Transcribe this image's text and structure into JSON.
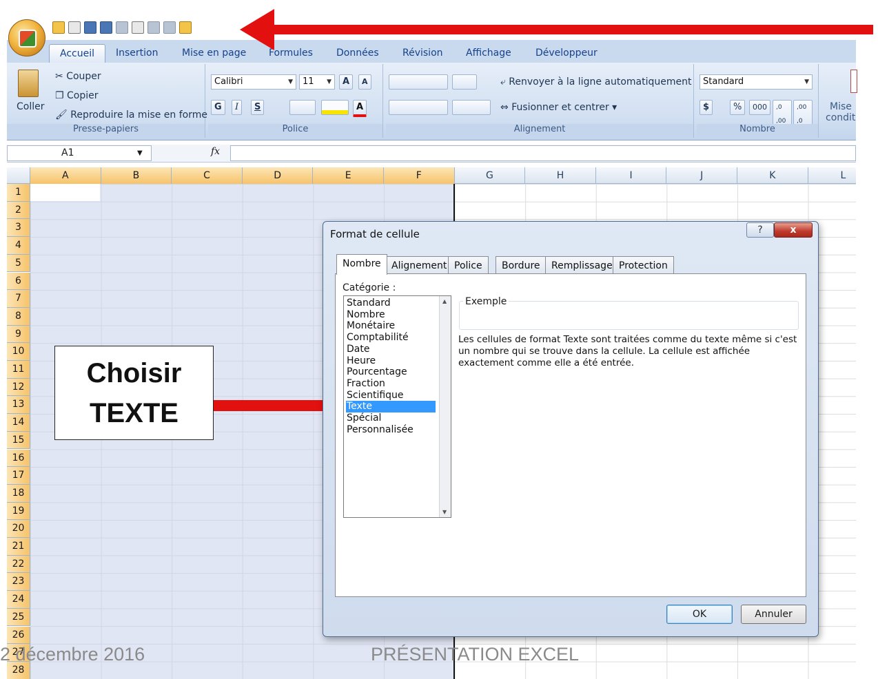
{
  "quick_access": {
    "icons": [
      "open-icon",
      "new-icon",
      "save-icon",
      "save-as-icon",
      "print-icon",
      "print-preview-icon",
      "undo-icon",
      "redo-icon",
      "customize-icon"
    ]
  },
  "ribbon": {
    "tabs": [
      "Accueil",
      "Insertion",
      "Mise en page",
      "Formules",
      "Données",
      "Révision",
      "Affichage",
      "Développeur"
    ],
    "active_tab": "Accueil",
    "clipboard": {
      "paste": "Coller",
      "cut": "Couper",
      "copy": "Copier",
      "format_painter": "Reproduire la mise en forme",
      "label": "Presse-papiers"
    },
    "font": {
      "name": "Calibri",
      "size": "11",
      "grow": "A",
      "shrink": "A",
      "bold": "G",
      "italic": "I",
      "underline": "S",
      "font_color": "A",
      "label": "Police"
    },
    "alignment": {
      "wrap": "Renvoyer à la ligne automatiquement",
      "merge": "Fusionner et centrer",
      "label": "Alignement"
    },
    "number": {
      "format": "Standard",
      "currency": "$",
      "percent": "%",
      "thousands": "000",
      "inc_dec": ",0 ,00",
      "dec_dec": ",00 ,0",
      "label": "Nombre"
    },
    "styles": {
      "cond_format_1": "Mise",
      "cond_format_2": "condit"
    }
  },
  "formula_bar": {
    "name_box": "A1",
    "fx": "fx",
    "formula": ""
  },
  "grid": {
    "columns": [
      "A",
      "B",
      "C",
      "D",
      "E",
      "F",
      "G",
      "H",
      "I",
      "J",
      "K",
      "L"
    ],
    "rows": [
      "1",
      "2",
      "3",
      "4",
      "5",
      "6",
      "7",
      "8",
      "9",
      "10",
      "11",
      "12",
      "13",
      "14",
      "15",
      "16",
      "17",
      "18",
      "19",
      "20",
      "21",
      "22",
      "23",
      "24",
      "25",
      "26",
      "27",
      "28"
    ]
  },
  "callout": {
    "line1": "Choisir",
    "line2": "TEXTE"
  },
  "dialog": {
    "title": "Format de cellule",
    "help": "?",
    "close": "x",
    "tabs": [
      "Nombre",
      "Alignement",
      "Police",
      "Bordure",
      "Remplissage",
      "Protection"
    ],
    "category_label": "Catégorie :",
    "categories": [
      "Standard",
      "Nombre",
      "Monétaire",
      "Comptabilité",
      "Date",
      "Heure",
      "Pourcentage",
      "Fraction",
      "Scientifique",
      "Texte",
      "Spécial",
      "Personnalisée"
    ],
    "selected_category": "Texte",
    "sample_label": "Exemple",
    "description": "Les cellules de format Texte sont traitées comme du texte même si c'est un nombre qui se trouve dans la cellule. La cellule est affichée exactement comme elle a été entrée.",
    "ok": "OK",
    "cancel": "Annuler"
  },
  "footer": {
    "date": "2 décembre 2016",
    "title": "PRÉSENTATION EXCEL"
  },
  "colors": {
    "arrow": "#e31010",
    "selection": "#c8d2eb",
    "ribbon": "#d2e0f2",
    "list_selected": "#3399ff"
  }
}
